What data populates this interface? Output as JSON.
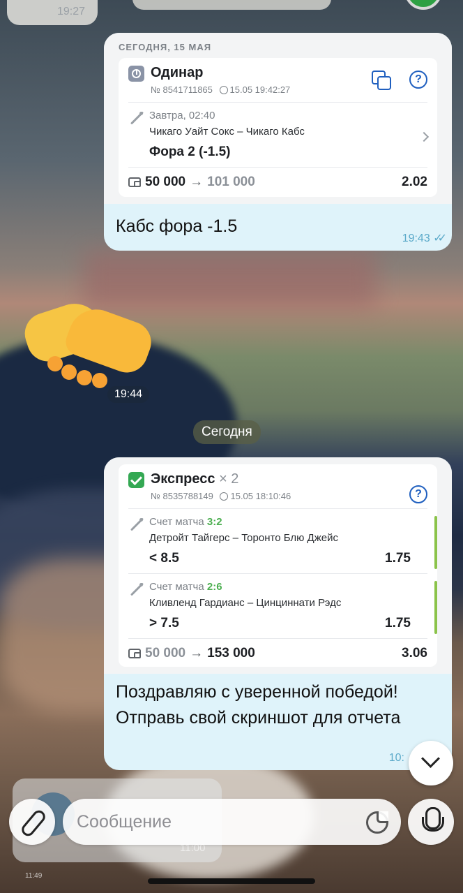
{
  "top": {
    "prev_time": "19:27"
  },
  "message1": {
    "date_label": "СЕГОДНЯ, 15 МАЯ",
    "bet_type": "Одинар",
    "bet_number": "№ 8541711865",
    "bet_datetime": "15.05 19:42:27",
    "event": {
      "time": "Завтра, 02:40",
      "teams": "Чикаго Уайт Сокс – Чикаго Кабс",
      "pick": "Фора 2 (-1.5)"
    },
    "stake": "50 000",
    "payout": "101 000",
    "odds": "2.02",
    "text": "Кабс фора -1.5",
    "time": "19:43"
  },
  "emoji_message": {
    "time": "19:44"
  },
  "day_separator": "Сегодня",
  "message2": {
    "bet_type": "Экспресс",
    "bet_count": "× 2",
    "bet_number": "№ 8535788149",
    "bet_datetime": "15.05 18:10:46",
    "events": [
      {
        "score_label": "Счет матча",
        "score": "3:2",
        "teams": "Детройт Тайгерс – Торонто Блю Джейс",
        "pick": "< 8.5",
        "odds": "1.75"
      },
      {
        "score_label": "Счет матча",
        "score": "2:6",
        "teams": "Кливленд Гардианс – Цинциннати Рэдс",
        "pick": "> 7.5",
        "odds": "1.75"
      }
    ],
    "stake": "50 000",
    "payout": "153 000",
    "odds": "3.06",
    "text_line1": "Поздравляю с уверенной победой!",
    "text_line2": "Отправь свой скриншот для отчета",
    "time": "10:"
  },
  "ghost": {
    "time": "11:00",
    "small_time": "11:49"
  },
  "composer": {
    "placeholder": "Сообщение"
  },
  "colors": {
    "bubble": "#dff3fa",
    "accent_blue": "#1f5fbf",
    "win_green": "#34a853"
  }
}
